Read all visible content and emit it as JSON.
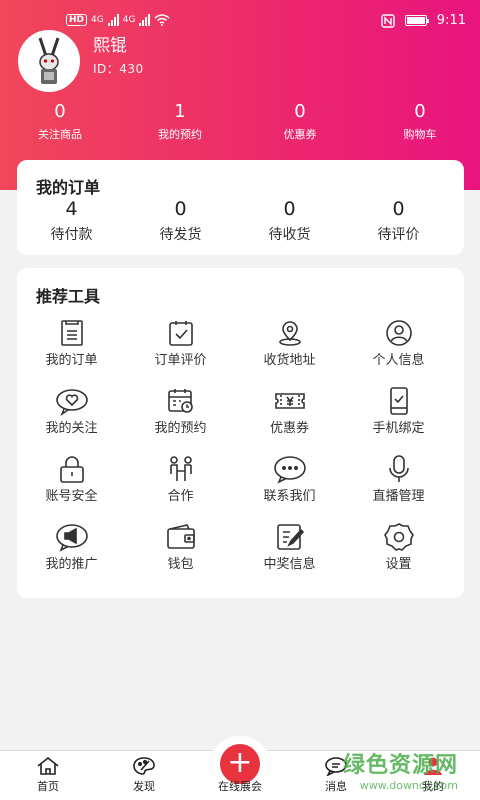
{
  "status_bar": {
    "network": "4G",
    "network2": "4G",
    "hd": "HD",
    "time": "9:11"
  },
  "user": {
    "name": "熙锟",
    "id_text": "ID：430"
  },
  "stats": [
    {
      "value": "0",
      "label": "关注商品"
    },
    {
      "value": "1",
      "label": "我的预约"
    },
    {
      "value": "0",
      "label": "优惠券"
    },
    {
      "value": "0",
      "label": "购物车"
    }
  ],
  "orders": {
    "title": "我的订单",
    "items": [
      {
        "value": "4",
        "label": "待付款"
      },
      {
        "value": "0",
        "label": "待发货"
      },
      {
        "value": "0",
        "label": "待收货"
      },
      {
        "value": "0",
        "label": "待评价"
      }
    ]
  },
  "tools": {
    "title": "推荐工具",
    "items": [
      {
        "label": "我的订单",
        "icon": "order-list-icon"
      },
      {
        "label": "订单评价",
        "icon": "review-clipboard-icon"
      },
      {
        "label": "收货地址",
        "icon": "location-pin-icon"
      },
      {
        "label": "个人信息",
        "icon": "person-icon"
      },
      {
        "label": "我的关注",
        "icon": "heart-chat-icon"
      },
      {
        "label": "我的预约",
        "icon": "calendar-clock-icon"
      },
      {
        "label": "优惠券",
        "icon": "coupon-ticket-icon"
      },
      {
        "label": "手机绑定",
        "icon": "phone-check-icon"
      },
      {
        "label": "账号安全",
        "icon": "lock-icon"
      },
      {
        "label": "合作",
        "icon": "handshake-people-icon"
      },
      {
        "label": "联系我们",
        "icon": "chat-bubble-icon"
      },
      {
        "label": "直播管理",
        "icon": "microphone-icon"
      },
      {
        "label": "我的推广",
        "icon": "megaphone-icon"
      },
      {
        "label": "钱包",
        "icon": "wallet-icon"
      },
      {
        "label": "中奖信息",
        "icon": "edit-note-icon"
      },
      {
        "label": "设置",
        "icon": "gear-icon"
      }
    ]
  },
  "tabbar": {
    "home": "首页",
    "discover": "发现",
    "center": "在线展会",
    "messages": "消息",
    "mine": "我的"
  },
  "watermark": {
    "line1": "绿色资源网",
    "line2": "www.downcc.com"
  },
  "colors": {
    "accent": "#e8343e",
    "header_start": "#f2465a",
    "header_end": "#e8147f"
  }
}
